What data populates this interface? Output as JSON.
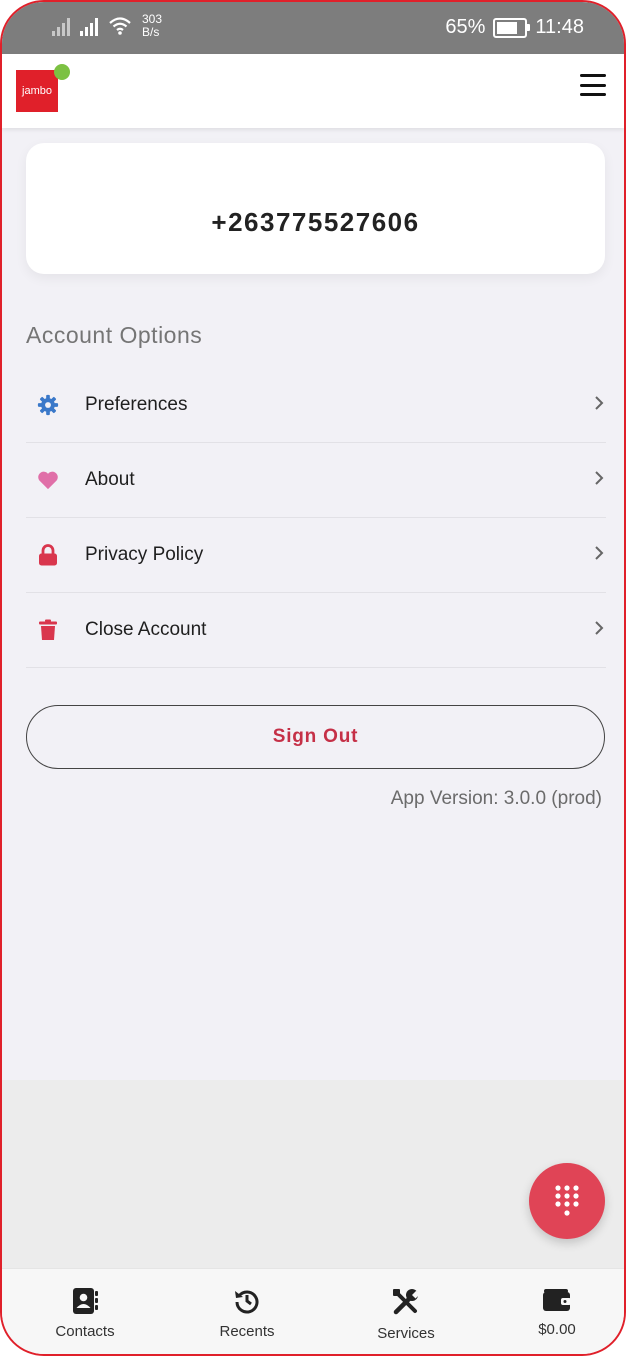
{
  "status_bar": {
    "net_speed_value": "303",
    "net_speed_unit": "B/s",
    "battery_percent": "65%",
    "battery_level": 0.65,
    "time": "11:48"
  },
  "app_bar": {
    "logo_text": "jambo",
    "menu_icon": "hamburger-menu-icon"
  },
  "account": {
    "phone_number": "+263775527606"
  },
  "account_options": {
    "title": "Account Options",
    "items": [
      {
        "label": "Preferences",
        "icon": "gear-icon",
        "color": "#3a78c9"
      },
      {
        "label": "About",
        "icon": "heart-icon",
        "color": "#e06fa8"
      },
      {
        "label": "Privacy Policy",
        "icon": "lock-icon",
        "color": "#d9364d"
      },
      {
        "label": "Close Account",
        "icon": "trash-icon",
        "color": "#d9364d"
      }
    ]
  },
  "sign_out_label": "Sign Out",
  "app_version": "App Version: 3.0.0 (prod)",
  "fab": {
    "icon": "dialpad-icon",
    "color": "#e04456"
  },
  "bottom_nav": [
    {
      "label": "Contacts",
      "icon": "contacts-book-icon"
    },
    {
      "label": "Recents",
      "icon": "history-icon"
    },
    {
      "label": "Services",
      "icon": "tools-icon"
    },
    {
      "label": "$0.00",
      "icon": "wallet-icon"
    }
  ],
  "colors": {
    "brand_red": "#e0202a",
    "accent_pink": "#c53047"
  }
}
